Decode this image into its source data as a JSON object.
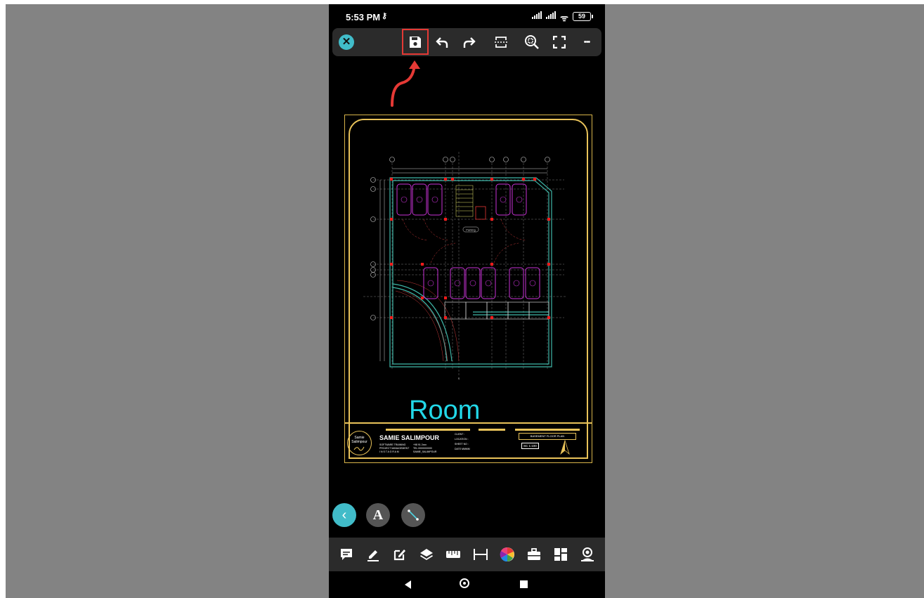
{
  "status_bar": {
    "time": "5:53 PM",
    "key_glyph": "⚷",
    "wifi_glyph": "ᯤ",
    "battery": "59"
  },
  "toolbar": {
    "close_glyph": "✕",
    "icons": [
      "save-icon",
      "undo-icon",
      "redo-icon",
      "select-window-icon",
      "zoom-extents-icon",
      "fullscreen-icon",
      "more-icon"
    ],
    "more_label": "•••",
    "highlight_color": "#e53935",
    "arrow_color": "#e53935"
  },
  "drawing": {
    "room_label": "Room",
    "title_block": {
      "badge_line1": "Samie",
      "badge_line2": "Salimpour",
      "designer_name": "SAMIE SALIMPOUR",
      "col1_row1": "SOFTWARE TRAINING",
      "col1_row2": "PROJECT MANAGEMENT",
      "col1_row3": "I N S T A G R A M",
      "col2_row1": "+98 91 2xxx",
      "col2_row2": "TEL 0000000000",
      "col2_row3": "SAMIE_SALIMPOUR",
      "col3_row1": "CLIENT :",
      "col3_row2": "LOCATION :",
      "col3_row3": "SHEET NO :",
      "col3_row4": "DATE MMMM",
      "plan_title": "BASEMENT FLOOR PLAN",
      "scale": "SC  1:100"
    },
    "parking_label": "Parking",
    "colors": {
      "border": "#e9c35a",
      "room_text": "#22d8e8",
      "walls": "#3fb6a8",
      "cars": "#c832d6",
      "dims": "#d0d0d0",
      "columns": "#ff1a1a"
    }
  },
  "floating": {
    "back_glyph": "‹",
    "text_glyph": "A",
    "line_tool": "line-tool-icon"
  },
  "bottom_bar": {
    "icons": [
      "comment-icon",
      "pen-icon",
      "edit-icon",
      "layers-icon",
      "ruler-icon",
      "dimension-icon",
      "color-wheel-icon",
      "toolbox-icon",
      "grid-icon",
      "user-icon"
    ]
  }
}
